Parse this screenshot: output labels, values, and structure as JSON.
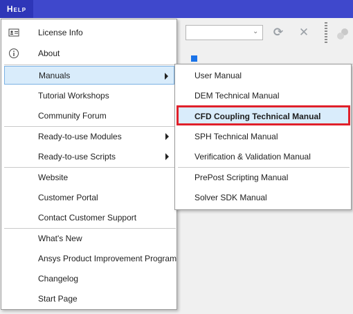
{
  "header": {
    "help_label": "Help"
  },
  "menu": {
    "items": [
      {
        "label": "License Info",
        "icon": "license-card-icon"
      },
      {
        "label": "About",
        "icon": "info-icon"
      },
      {
        "label": "Manuals",
        "has_submenu": true,
        "active": true
      },
      {
        "label": "Tutorial Workshops"
      },
      {
        "label": "Community Forum"
      },
      {
        "label": "Ready-to-use Modules",
        "has_submenu": true
      },
      {
        "label": "Ready-to-use Scripts",
        "has_submenu": true
      },
      {
        "label": "Website"
      },
      {
        "label": "Customer Portal"
      },
      {
        "label": "Contact Customer Support"
      },
      {
        "label": "What's New"
      },
      {
        "label": "Ansys Product Improvement Program"
      },
      {
        "label": "Changelog"
      },
      {
        "label": "Start Page"
      }
    ]
  },
  "submenu": {
    "items": [
      {
        "label": "User Manual"
      },
      {
        "label": "DEM Technical Manual"
      },
      {
        "label": "CFD Coupling Technical Manual",
        "highlighted": true
      },
      {
        "label": "SPH Technical Manual"
      },
      {
        "label": "Verification & Validation Manual"
      },
      {
        "label": "PrePost Scripting Manual"
      },
      {
        "label": "Solver  SDK Manual"
      }
    ]
  },
  "colors": {
    "topbar": "#3f48cc",
    "active_item": "#d9ecfb",
    "highlight_outline": "#e0202a"
  }
}
